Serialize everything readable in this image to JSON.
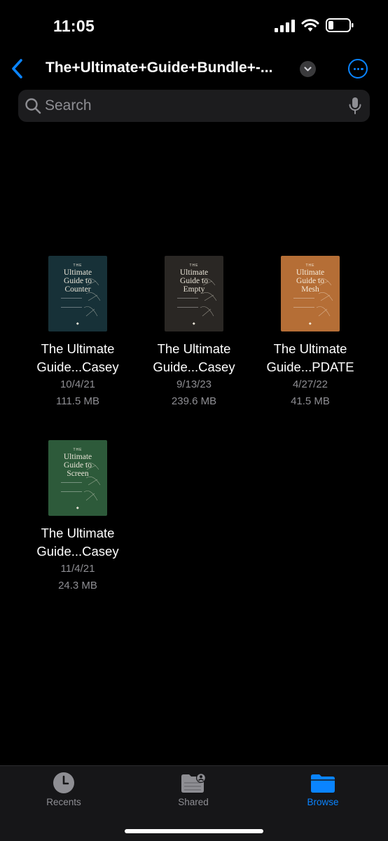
{
  "status": {
    "time": "11:05"
  },
  "nav": {
    "title": "The+Ultimate+Guide+Bundle+-..."
  },
  "search": {
    "placeholder": "Search"
  },
  "files": [
    {
      "name_line1": "The Ultimate",
      "name_line2": "Guide...Casey",
      "date": "10/4/21",
      "size": "111.5 MB",
      "cover": {
        "kicker": "THE",
        "line1": "Ultimate",
        "line2": "Guide to",
        "line3": "Counter",
        "bg": "#173138",
        "fg": "#e8e3d6"
      }
    },
    {
      "name_line1": "The Ultimate",
      "name_line2": "Guide...Casey",
      "date": "9/13/23",
      "size": "239.6 MB",
      "cover": {
        "kicker": "THE",
        "line1": "Ultimate",
        "line2": "Guide to",
        "line3": "Empty",
        "bg": "#2a2724",
        "fg": "#e8e3d6"
      }
    },
    {
      "name_line1": "The Ultimate",
      "name_line2": "Guide...PDATE",
      "date": "4/27/22",
      "size": "41.5 MB",
      "cover": {
        "kicker": "THE",
        "line1": "Ultimate",
        "line2": "Guide to",
        "line3": "Mesh",
        "bg": "#b56e36",
        "fg": "#f5ead8"
      }
    },
    {
      "name_line1": "The Ultimate",
      "name_line2": "Guide...Casey",
      "date": "11/4/21",
      "size": "24.3 MB",
      "cover": {
        "kicker": "THE",
        "line1": "Ultimate",
        "line2": "Guide to",
        "line3": "Screen",
        "bg": "#2d5a3a",
        "fg": "#e8e3d6"
      }
    }
  ],
  "tabs": [
    {
      "label": "Recents",
      "icon": "clock-icon",
      "active": false
    },
    {
      "label": "Shared",
      "icon": "shared-folder-icon",
      "active": false
    },
    {
      "label": "Browse",
      "icon": "folder-icon",
      "active": true
    }
  ],
  "colors": {
    "accent": "#0a84ff",
    "secondary_text": "#8e8e93",
    "background": "#000000"
  }
}
